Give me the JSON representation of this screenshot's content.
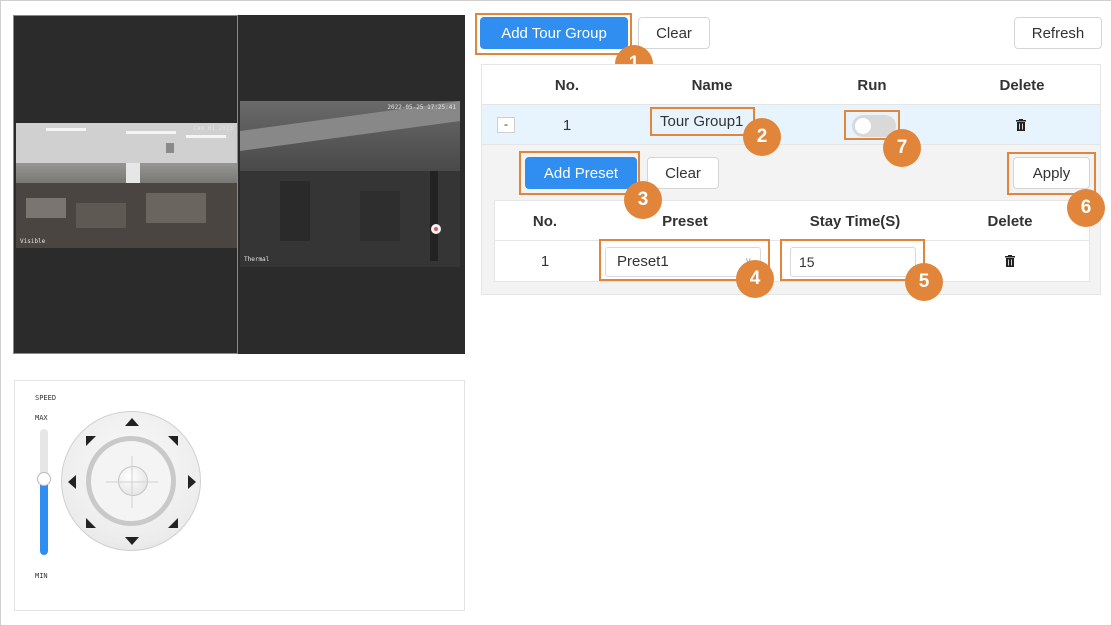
{
  "video": {
    "left_caption": "Visible",
    "right_caption": "Thermal",
    "left_osd": "Cam 01 2023",
    "right_osd": "2022-05-25 17:25:41"
  },
  "ptz": {
    "speed_label": "SPEED",
    "max_label": "MAX",
    "min_label": "MIN",
    "speed_level": 0.6
  },
  "toolbar": {
    "add_tour_group": "Add Tour Group",
    "clear": "Clear",
    "refresh": "Refresh"
  },
  "group_table": {
    "headers": {
      "no": "No.",
      "name": "Name",
      "run": "Run",
      "delete": "Delete"
    },
    "rows": [
      {
        "expand": "-",
        "no": "1",
        "name": "Tour Group1",
        "run": false
      }
    ]
  },
  "preset_toolbar": {
    "add_preset": "Add Preset",
    "clear": "Clear",
    "apply": "Apply"
  },
  "preset_table": {
    "headers": {
      "no": "No.",
      "preset": "Preset",
      "stay_time": "Stay Time(S)",
      "delete": "Delete"
    },
    "rows": [
      {
        "no": "1",
        "preset": "Preset1",
        "stay_time": "15"
      }
    ]
  },
  "callouts": [
    "1",
    "2",
    "3",
    "4",
    "5",
    "6",
    "7"
  ],
  "colors": {
    "accent": "#2f8ef0",
    "callout": "#e0853a",
    "selection": "#22c55e"
  }
}
